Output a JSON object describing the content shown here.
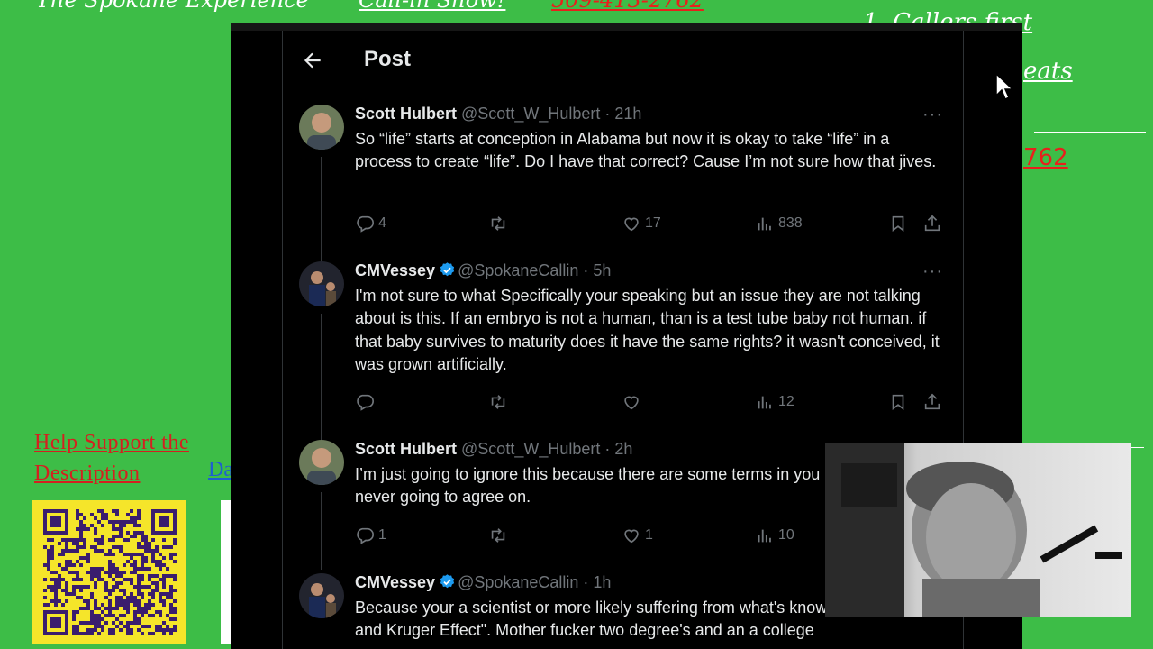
{
  "overlay": {
    "title_fragment": "The Spokane Experience",
    "show_fragment": "Call-in Show!",
    "phone_fragment": "509-413-2762",
    "rule_1": "1. Callers first",
    "rule_2": "eats",
    "phone_fragment_2": "762",
    "help_line1": "Help Support the",
    "help_line2": "Description",
    "help_link": "Da"
  },
  "post": {
    "back_icon": "arrow-left-icon",
    "title": "Post"
  },
  "tweets": [
    {
      "name": "Scott Hulbert",
      "handle": "@Scott_W_Hulbert",
      "sep": " · ",
      "time": "21h",
      "verified": false,
      "more": "···",
      "text": "So “life” starts at conception in Alabama but now it is okay to take “life” in a process to create “life”. Do I have that correct? Cause I’m not sure how that jives.",
      "replies": "4",
      "retweets": "",
      "likes": "17",
      "views": "838"
    },
    {
      "name": "CMVessey",
      "handle": "@SpokaneCallin",
      "sep": " · ",
      "time": "5h",
      "verified": true,
      "more": "···",
      "text": "I'm not sure to what Specifically your speaking but an issue they are not talking about is this. If an embryo is not a human, than is a test tube baby not human. if that baby survives to maturity does it have the same rights?  it wasn't conceived,  it was grown artificially.",
      "replies": "",
      "retweets": "",
      "likes": "",
      "views": "12"
    },
    {
      "name": "Scott Hulbert",
      "handle": "@Scott_W_Hulbert",
      "sep": " · ",
      "time": "2h",
      "verified": false,
      "more": "",
      "text": "I’m just going to ignore this because there are some terms in you and I/science are never going to agree on.",
      "replies": "1",
      "retweets": "",
      "likes": "1",
      "views": "10"
    },
    {
      "name": "CMVessey",
      "handle": "@SpokaneCallin",
      "sep": " · ",
      "time": "1h",
      "verified": true,
      "more": "",
      "text": "Because your a scientist or more likely suffering from  what's known as \"Dunning and  Kruger Effect\". Mother fucker two degree's and an a college",
      "replies": "",
      "retweets": "",
      "likes": "",
      "views": ""
    }
  ],
  "colors": {
    "green_screen": "#3dbd47",
    "twitter_bg": "#000000",
    "text_primary": "#e7e9ea",
    "text_secondary": "#71767b",
    "verified_blue": "#1d9bf0",
    "overlay_red": "#e8201c"
  },
  "icons": {
    "reply": "reply-icon",
    "retweet": "retweet-icon",
    "like": "heart-icon",
    "views": "views-icon",
    "bookmark": "bookmark-icon",
    "share": "share-icon",
    "more": "more-icon",
    "verified": "verified-badge-icon",
    "qr": "qr-code-icon",
    "cursor": "mouse-cursor-icon"
  }
}
